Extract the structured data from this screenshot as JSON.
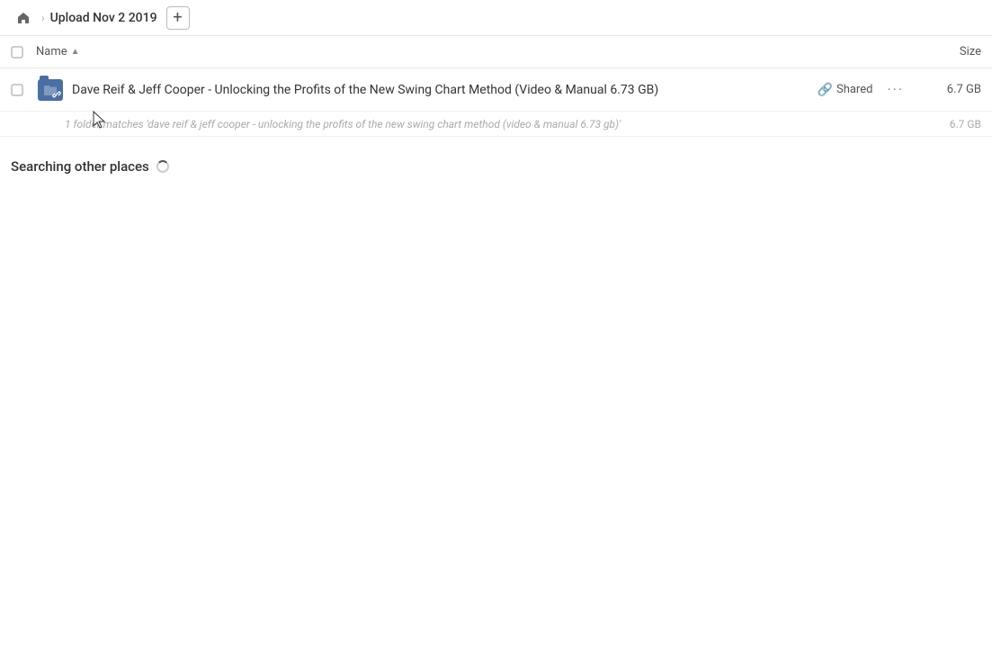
{
  "topbar": {
    "home_title": "Home",
    "breadcrumb_label": "Upload Nov 2 2019",
    "add_button_label": "+"
  },
  "columns": {
    "name_label": "Name",
    "size_label": "Size"
  },
  "result": {
    "icon_type": "folder",
    "name": "Dave Reif & Jeff Cooper - Unlocking the Profits of the New Swing Chart Method (Video & Manual 6.73 GB)",
    "shared_label": "Shared",
    "size": "6.7 GB",
    "match_text": "1 folder matches 'dave reif & jeff cooper - unlocking the profits of the new swing chart method (video & manual 6.73 gb)'",
    "match_size": "6.7 GB"
  },
  "searching": {
    "label": "Searching other places"
  }
}
